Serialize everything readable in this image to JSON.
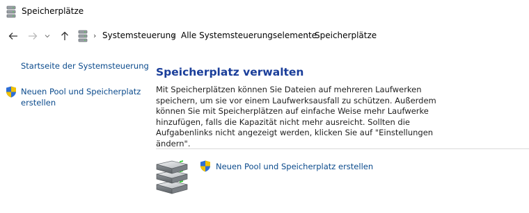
{
  "window": {
    "title": "Speicherplätze"
  },
  "nav": {
    "back": "back-arrow",
    "forward": "forward-arrow",
    "recent": "chevron-down",
    "up": "up-arrow"
  },
  "breadcrumb": {
    "items": [
      "Systemsteuerung",
      "Alle Systemsteuerungselemente",
      "Speicherplätze"
    ],
    "separator": "›"
  },
  "sidebar": {
    "home_link": "Startseite der Systemsteuerung",
    "new_pool_link": "Neuen Pool und Speicherplatz erstellen"
  },
  "main": {
    "heading": "Speicherplatz verwalten",
    "description": "Mit Speicherplätzen können Sie Dateien auf mehreren Laufwerken speichern, um sie vor einem Laufwerksausfall zu schützen. Außerdem können Sie mit Speicherplätzen auf einfache Weise mehr Laufwerke hinzufügen, falls die Kapazität nicht mehr ausreicht. Sollten die Aufgabenlinks nicht angezeigt werden, klicken Sie auf \"Einstellungen ändern\".",
    "task_link": "Neuen Pool und Speicherplatz erstellen"
  },
  "colors": {
    "link": "#0a4a8c",
    "heading": "#1a3e9a",
    "shield_blue": "#2f6fd6",
    "shield_yellow": "#f2c200"
  }
}
